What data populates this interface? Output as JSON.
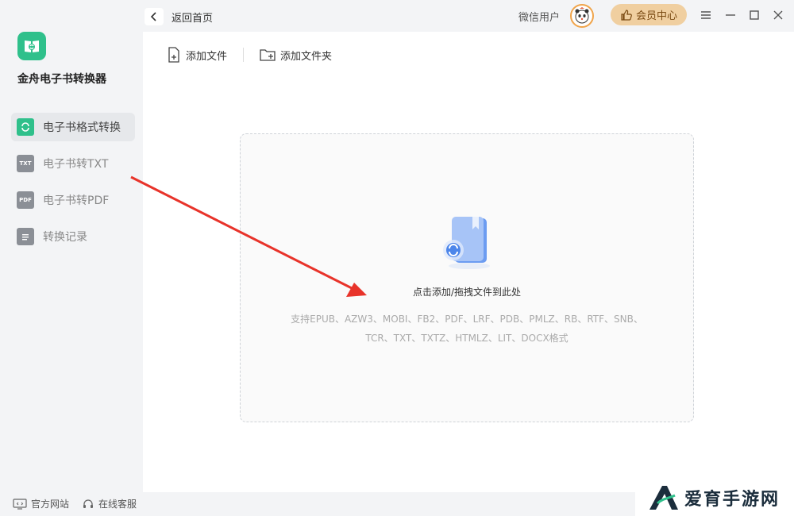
{
  "app": {
    "name": "金舟电子书转换器"
  },
  "sidebar": {
    "items": [
      {
        "label": "电子书格式转换",
        "icon": "refresh-icon",
        "icon_text": "",
        "active": true
      },
      {
        "label": "电子书转TXT",
        "icon": "txt-icon",
        "icon_text": "TXT",
        "active": false
      },
      {
        "label": "电子书转PDF",
        "icon": "pdf-icon",
        "icon_text": "PDF",
        "active": false
      },
      {
        "label": "转换记录",
        "icon": "record-icon",
        "icon_text": "",
        "active": false
      }
    ],
    "footer": {
      "website": "官方网站",
      "support": "在线客服"
    }
  },
  "topbar": {
    "back_label": "返回首页",
    "user_name": "微信用户",
    "vip_label": "会员中心"
  },
  "toolbar": {
    "add_file": "添加文件",
    "add_folder": "添加文件夹"
  },
  "dropzone": {
    "title": "点击添加/拖拽文件到此处",
    "formats_line1": "支持EPUB、AZW3、MOBI、FB2、PDF、LRF、PDB、PMLZ、RB、RTF、SNB、",
    "formats_line2": "TCR、TXT、TXTZ、HTMLZ、LIT、DOCX格式"
  },
  "watermark": {
    "text": "爱育手游网",
    "logo_letter": "A"
  },
  "colors": {
    "accent": "#2fc08b",
    "vip_bg": "#f0cfa0",
    "arrow": "#e8332a"
  }
}
